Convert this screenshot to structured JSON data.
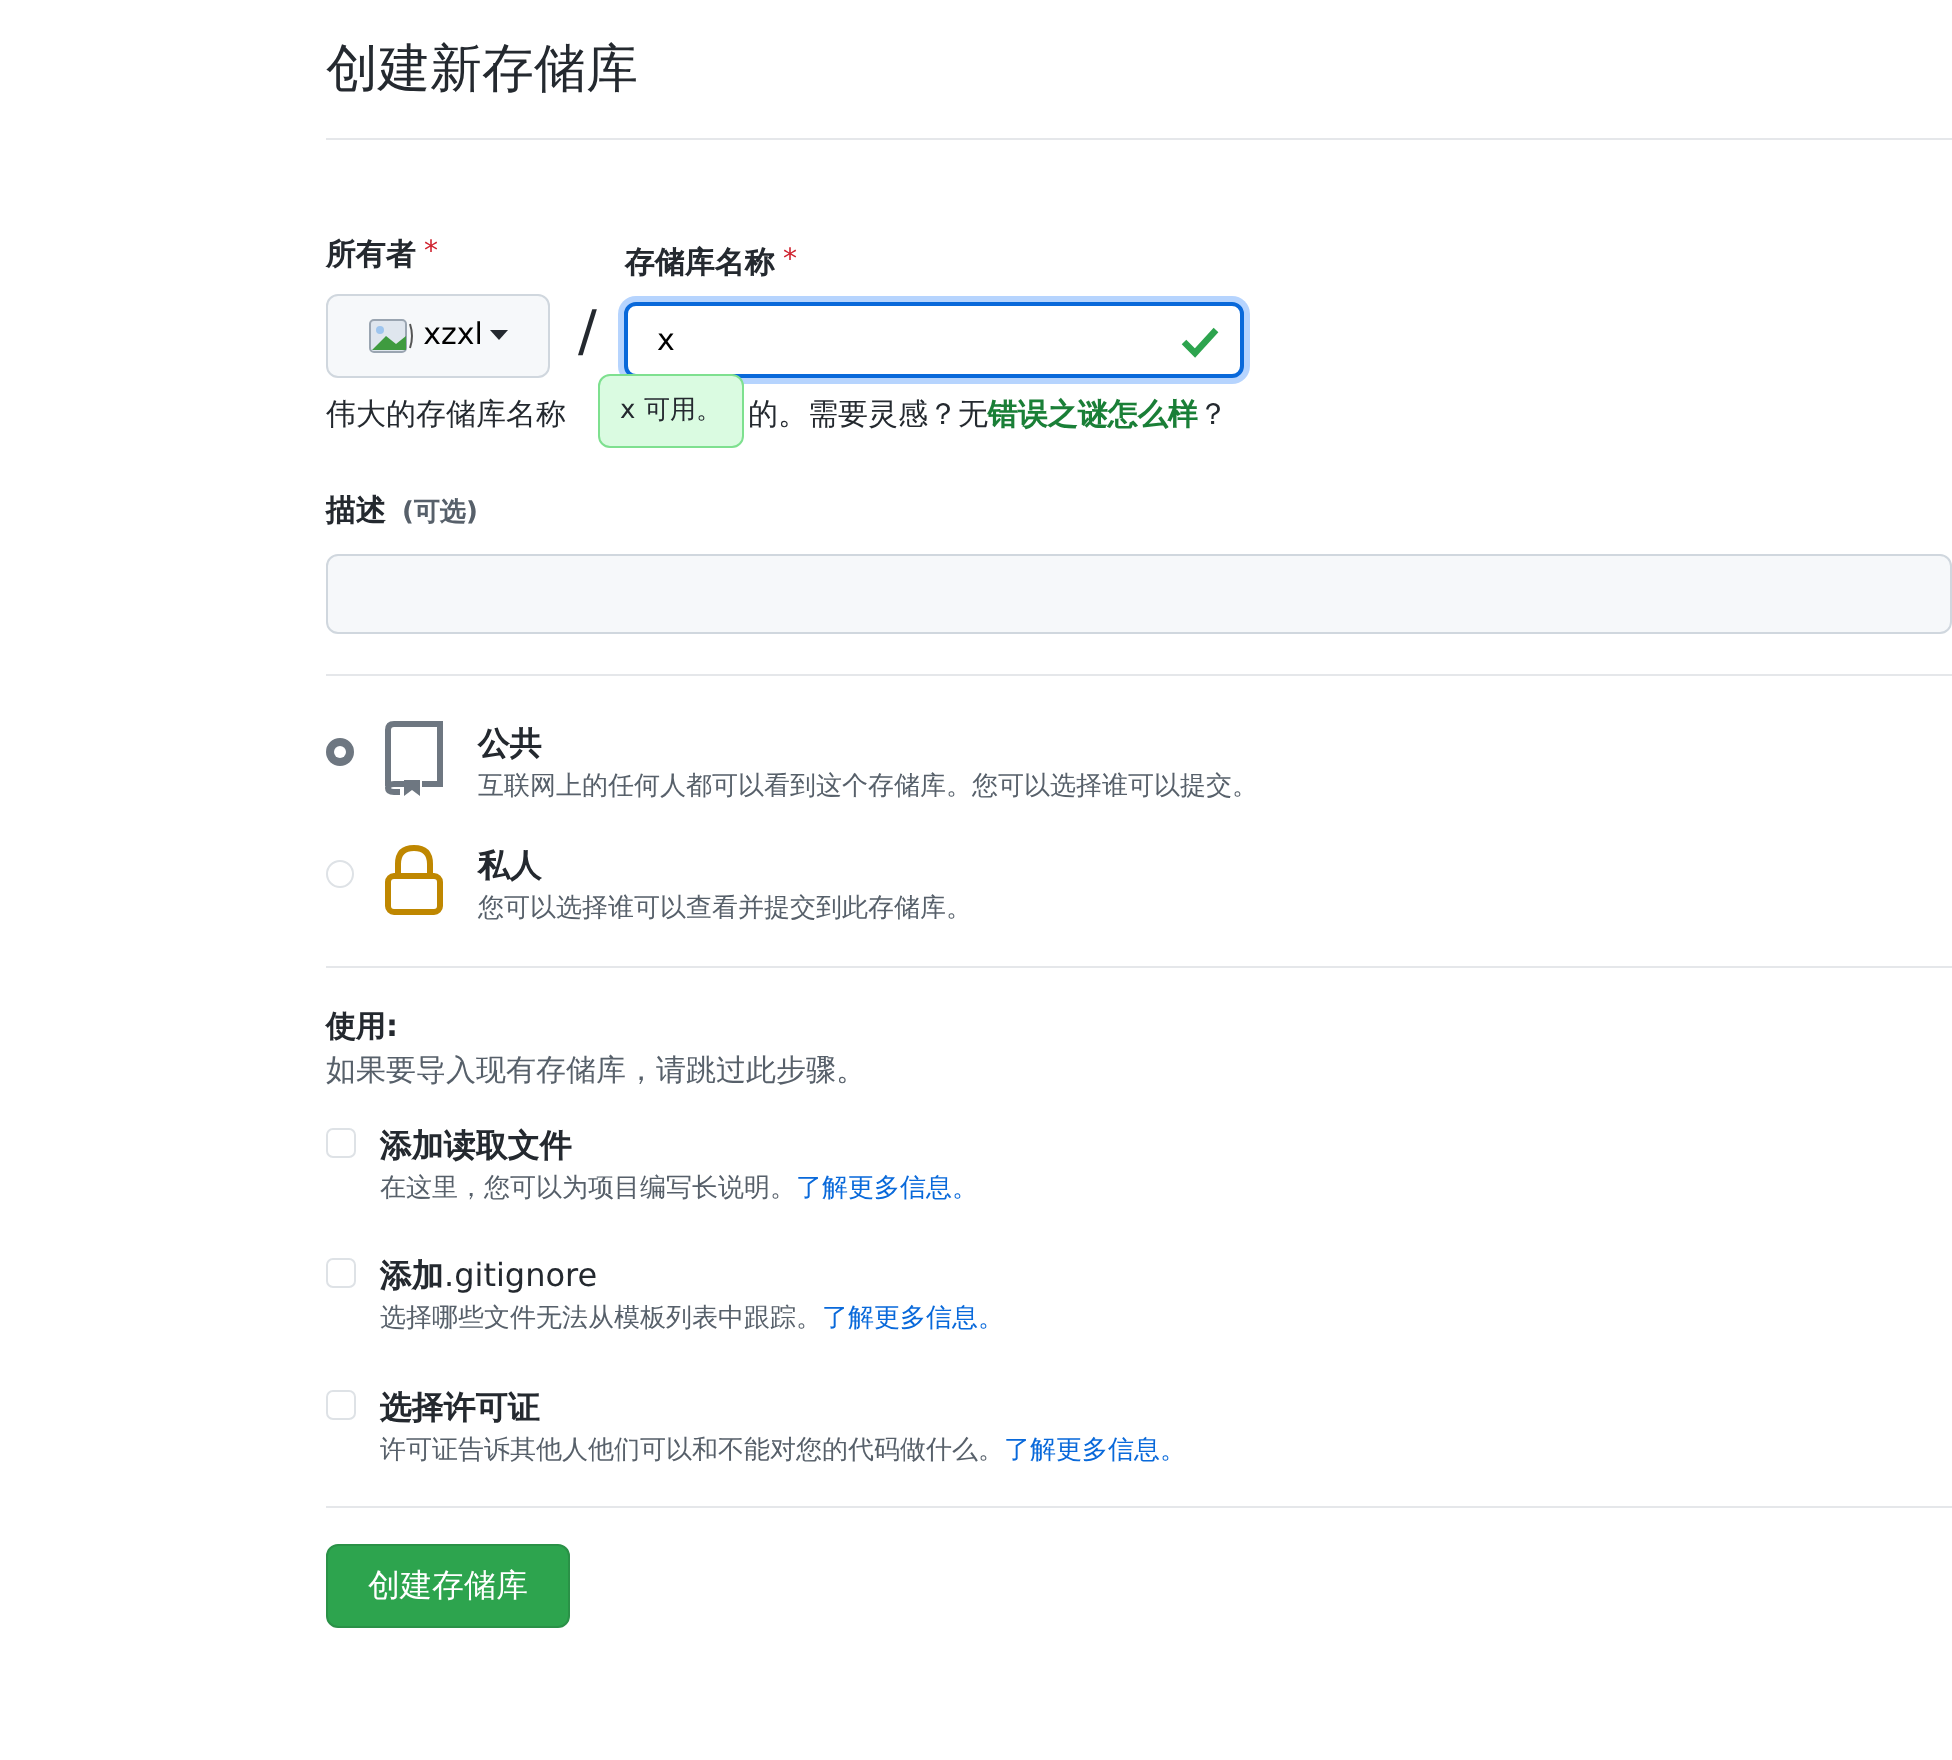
{
  "title": "创建新存储库",
  "owner": {
    "label": "所有者",
    "required_mark": "*",
    "value": "xzxl"
  },
  "separator": "/",
  "repo_name": {
    "label": "存储库名称",
    "required_mark": "*",
    "value": "x",
    "valid": true
  },
  "tooltip": "x 可用。",
  "hint_before": "伟大的存储库名称",
  "hint_after": "的。需要灵感？无**错误之谜怎么样**？",
  "description": {
    "label": "描述",
    "optional": "(可选)"
  },
  "visibility": [
    {
      "kind": "book",
      "title": "公共",
      "text": "互联网上的任何人都可以看到这个存储库。您可以选择谁可以提交。",
      "selected": true
    },
    {
      "kind": "lock",
      "title": "私人",
      "text": "您可以选择谁可以查看并提交到此存储库。",
      "selected": false
    }
  ],
  "init": {
    "title": "使用:",
    "text": "如果要导入现有存储库，请跳过此步骤。"
  },
  "options": [
    {
      "title": "添加读取文件",
      "text": "在这里，您可以为项目编写长说明。",
      "link": "了解更多信息。",
      "checked": false
    },
    {
      "title": "添加**.gitignore**",
      "text": "选择哪些文件无法从模板列表中跟踪。",
      "link": "了解更多信息。",
      "checked": false
    },
    {
      "title": "选择许可证",
      "text": "许可证告诉其他人他们可以和不能对您的代码做什么。",
      "link": "了解更多信息。",
      "checked": false
    }
  ],
  "submit": "创建存储库"
}
